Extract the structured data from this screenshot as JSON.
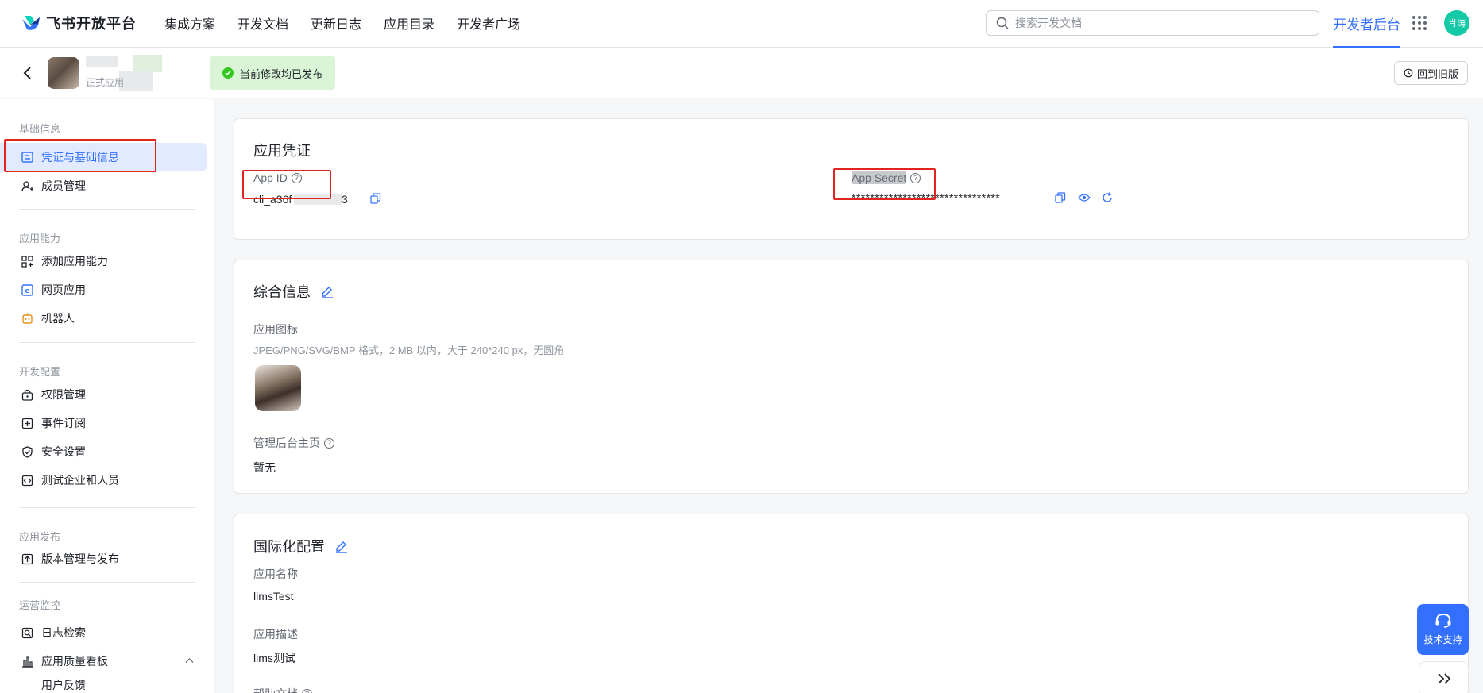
{
  "brand": {
    "name": "飞书开放平台"
  },
  "topnav": {
    "links": [
      "集成方案",
      "开发文档",
      "更新日志",
      "应用目录",
      "开发者广场"
    ],
    "search_placeholder": "搜索开发文档",
    "dev_console": "开发者后台",
    "user_initials": "肖涛"
  },
  "appbar": {
    "app_type": "正式应用",
    "publish_status": "当前修改均已发布",
    "old_version_button": "回到旧版"
  },
  "sidebar": {
    "groups": [
      {
        "label": "基础信息",
        "items": [
          {
            "label": "凭证与基础信息",
            "icon": "credential-icon",
            "active": true
          },
          {
            "label": "成员管理",
            "icon": "member-icon"
          }
        ]
      },
      {
        "label": "应用能力",
        "items": [
          {
            "label": "添加应用能力",
            "icon": "add-capability-icon"
          },
          {
            "label": "网页应用",
            "icon": "web-app-icon"
          },
          {
            "label": "机器人",
            "icon": "robot-icon"
          }
        ]
      },
      {
        "label": "开发配置",
        "items": [
          {
            "label": "权限管理",
            "icon": "permission-icon"
          },
          {
            "label": "事件订阅",
            "icon": "event-icon"
          },
          {
            "label": "安全设置",
            "icon": "shield-icon"
          },
          {
            "label": "测试企业和人员",
            "icon": "code-icon"
          }
        ]
      },
      {
        "label": "应用发布",
        "items": [
          {
            "label": "版本管理与发布",
            "icon": "upload-icon"
          }
        ]
      },
      {
        "label": "运营监控",
        "items": [
          {
            "label": "日志检索",
            "icon": "log-search-icon"
          },
          {
            "label": "应用质量看板",
            "icon": "chart-icon"
          },
          {
            "label": "用户反馈",
            "icon": "feedback-icon"
          }
        ]
      }
    ]
  },
  "credentials": {
    "title": "应用凭证",
    "app_id_label": "App ID",
    "app_id_value": "cli_a36f",
    "app_id_tail": "3",
    "app_secret_label": "App Secret",
    "app_secret_value": "********************************"
  },
  "general": {
    "title": "综合信息",
    "icon_label": "应用图标",
    "icon_hint": "JPEG/PNG/SVG/BMP 格式，2 MB 以内，大于 240*240 px，无圆角",
    "admin_home_label": "管理后台主页",
    "admin_home_value": "暂无"
  },
  "i18n": {
    "title": "国际化配置",
    "name_label": "应用名称",
    "name_value": "limsTest",
    "desc_label": "应用描述",
    "desc_value": "lims测试",
    "help_label": "帮助文档"
  },
  "support": {
    "label": "技术支持"
  },
  "colors": {
    "accent": "#3370ff",
    "success_bg": "#d9f5d6",
    "annotation_red": "#e3231d"
  }
}
